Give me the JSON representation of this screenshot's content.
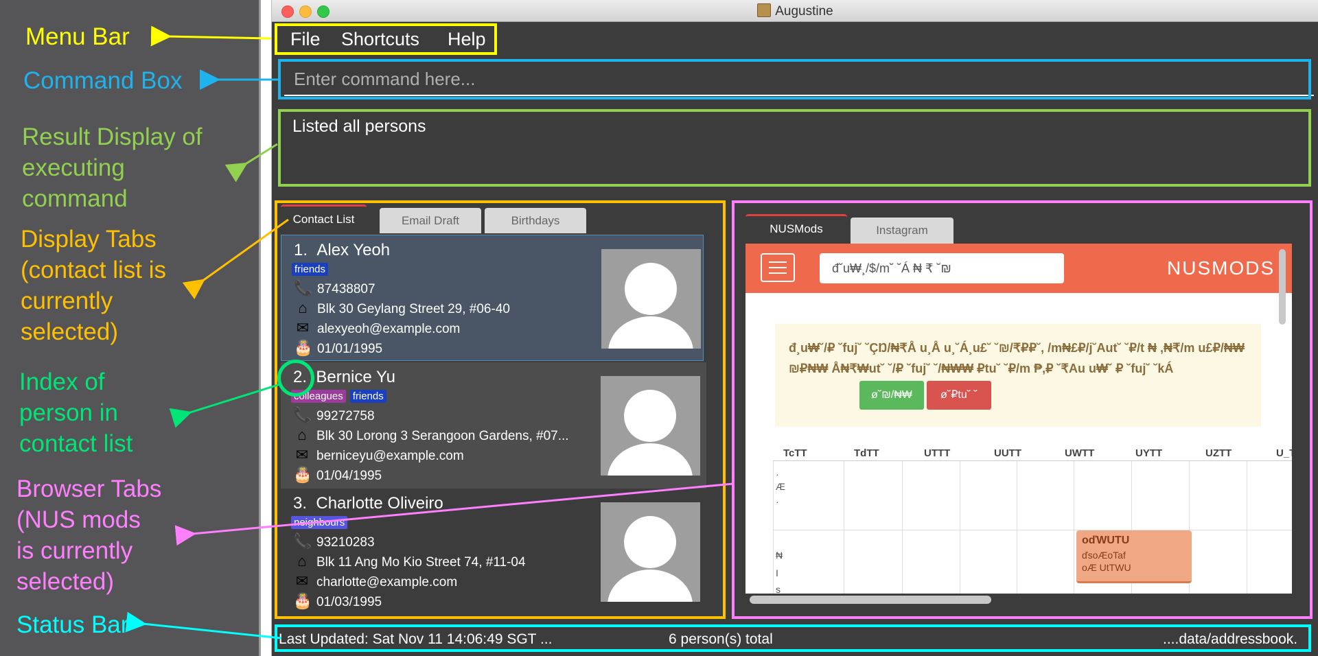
{
  "annotations": [
    {
      "name": "menu-bar-annotation",
      "text": "Menu Bar",
      "color": "#ffff00"
    },
    {
      "name": "command-box-annotation",
      "text": "Command Box",
      "color": "#1fb3ee"
    },
    {
      "name": "result-display-annotation",
      "text": "Result Display of\nexecuting\ncommand",
      "color": "#92d050"
    },
    {
      "name": "display-tabs-annotation",
      "text": "Display Tabs\n(contact list is\ncurrently\nselected)",
      "color": "#ffc000"
    },
    {
      "name": "index-annotation",
      "text": "Index of\nperson in\ncontact list",
      "color": "#00e676"
    },
    {
      "name": "browser-tabs-annotation",
      "text": "Browser Tabs\n(NUS mods\nis currently\nselected)",
      "color": "#ff80ff"
    },
    {
      "name": "status-bar-annotation",
      "text": "Status Bar",
      "color": "#00ffff"
    }
  ],
  "window": {
    "title": "Augustine"
  },
  "menu": [
    "File",
    "Shortcuts",
    "Help"
  ],
  "command": {
    "placeholder": "Enter command here...",
    "value": ""
  },
  "result": {
    "text": "Listed all persons"
  },
  "display_tabs": [
    {
      "label": "Contact List",
      "active": true
    },
    {
      "label": "Email Draft",
      "active": false
    },
    {
      "label": "Birthdays",
      "active": false
    }
  ],
  "persons": [
    {
      "index": "1.",
      "name": "Alex Yeoh",
      "tags": [
        {
          "label": "friends",
          "color": "#1a3fbf"
        }
      ],
      "phone": "87438807",
      "address": "Blk 30 Geylang Street 29, #06-40",
      "email": "alexyeoh@example.com",
      "birthday": "01/01/1995",
      "selected": true
    },
    {
      "index": "2.",
      "name": "Bernice Yu",
      "tags": [
        {
          "label": "colleagues",
          "color": "#9b3b9b"
        },
        {
          "label": "friends",
          "color": "#1a3fbf"
        }
      ],
      "phone": "99272758",
      "address": "Blk 30 Lorong 3 Serangoon Gardens, #07...",
      "email": "berniceyu@example.com",
      "birthday": "01/04/1995",
      "selected": false
    },
    {
      "index": "3.",
      "name": "Charlotte Oliveiro",
      "tags": [
        {
          "label": "neighbours",
          "color": "#5555dd"
        }
      ],
      "phone": "93210283",
      "address": "Blk 11 Ang Mo Kio Street 74, #11-04",
      "email": "charlotte@example.com",
      "birthday": "01/03/1995",
      "selected": false
    }
  ],
  "icons": {
    "phone": "phone-icon",
    "address": "home-icon",
    "email": "mail-icon",
    "birthday": "cake-icon"
  },
  "browser_tabs": [
    {
      "label": "NUSMods",
      "active": true
    },
    {
      "label": "Instagram",
      "active": false
    }
  ],
  "nusmods": {
    "logo": "NUSMODS",
    "search_text": "đ˘u₩¸/$/m˘ ˘Á ₦ ₹ ˘₪",
    "alert_text": "đ¸u₩˘/₽ ˘fuj˘ ˘ÇŊ/₦₹Å u¸Å u¸˘Á¸u£˘ ˘₪/₹₽₽˘, /m₦£₽/j˘Aut˘ ˘₽/t ₦ ,₦₹/m u£₽/₦₩ ₪₽₦₩ Å₦₹₩ut˘ ˘/₽ ˘fuj˘ ˘/₦₩₩ ₽tu˘ ˘₽/m ₱,₽ ˘₹Au u₩˘ ₽ ˘fuj˘ ˘kÁ",
    "btn_primary": "ø˘₪/₦₩",
    "btn_danger": "ø˘₽tu˘ ˘",
    "days": [
      "TcTT",
      "TdTT",
      "UTTT",
      "UUTT",
      "UWTT",
      "UYTT",
      "UZTT",
      "U_T"
    ],
    "lesson": {
      "code": "oďWUTU",
      "line2": "ďsoÆoTaf",
      "line3": "oÆ UtTWU"
    },
    "side_labels": [
      "·",
      "Æ",
      "·",
      "₦",
      "I",
      "s"
    ]
  },
  "status": {
    "last_updated": "Last Updated: Sat Nov 11 14:06:49 SGT ...",
    "total": "6 person(s) total",
    "path": "....data/addressbook."
  },
  "highlight_colors": {
    "menu": "#ffff00",
    "command": "#1fb3ee",
    "result": "#92d050",
    "tabs": "#ffc000",
    "browser": "#ff80ff",
    "status": "#00ffff",
    "index": "#00e676"
  }
}
